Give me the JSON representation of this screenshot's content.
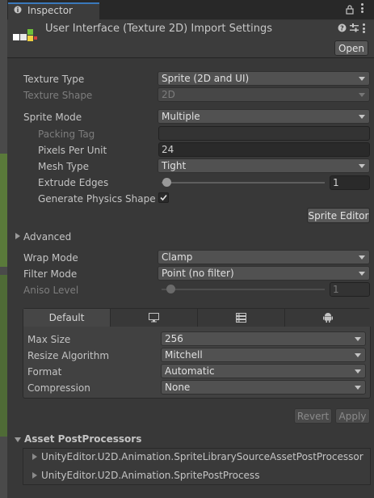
{
  "tab": {
    "label": "Inspector"
  },
  "header": {
    "title": "User Interface (Texture 2D) Import Settings",
    "open_label": "Open"
  },
  "fields": {
    "texture_type": {
      "label": "Texture Type",
      "value": "Sprite (2D and UI)"
    },
    "texture_shape": {
      "label": "Texture Shape",
      "value": "2D"
    },
    "sprite_mode": {
      "label": "Sprite Mode",
      "value": "Multiple"
    },
    "packing_tag": {
      "label": "Packing Tag",
      "value": ""
    },
    "pixels_per_unit": {
      "label": "Pixels Per Unit",
      "value": "24"
    },
    "mesh_type": {
      "label": "Mesh Type",
      "value": "Tight"
    },
    "extrude_edges": {
      "label": "Extrude Edges",
      "value": "1"
    },
    "generate_physics": {
      "label": "Generate Physics Shape",
      "checked": true
    },
    "sprite_editor_label": "Sprite Editor",
    "advanced_label": "Advanced",
    "wrap_mode": {
      "label": "Wrap Mode",
      "value": "Clamp"
    },
    "filter_mode": {
      "label": "Filter Mode",
      "value": "Point (no filter)"
    },
    "aniso_level": {
      "label": "Aniso Level",
      "value": "1"
    }
  },
  "platform": {
    "default_tab": "Default",
    "tab_icons": [
      "monitor-icon",
      "server-icon",
      "android-icon"
    ],
    "max_size": {
      "label": "Max Size",
      "value": "256"
    },
    "resize_algorithm": {
      "label": "Resize Algorithm",
      "value": "Mitchell"
    },
    "format": {
      "label": "Format",
      "value": "Automatic"
    },
    "compression": {
      "label": "Compression",
      "value": "None"
    }
  },
  "actions": {
    "revert": "Revert",
    "apply": "Apply"
  },
  "postprocessors": {
    "title": "Asset PostProcessors",
    "items": [
      "UnityEditor.U2D.Animation.SpriteLibrarySourceAssetPostProcessor",
      "UnityEditor.U2D.Animation.SpritePostProcess"
    ]
  },
  "colors": {
    "accent": "#3a79bb",
    "background": "#383838",
    "button": "#585858"
  }
}
